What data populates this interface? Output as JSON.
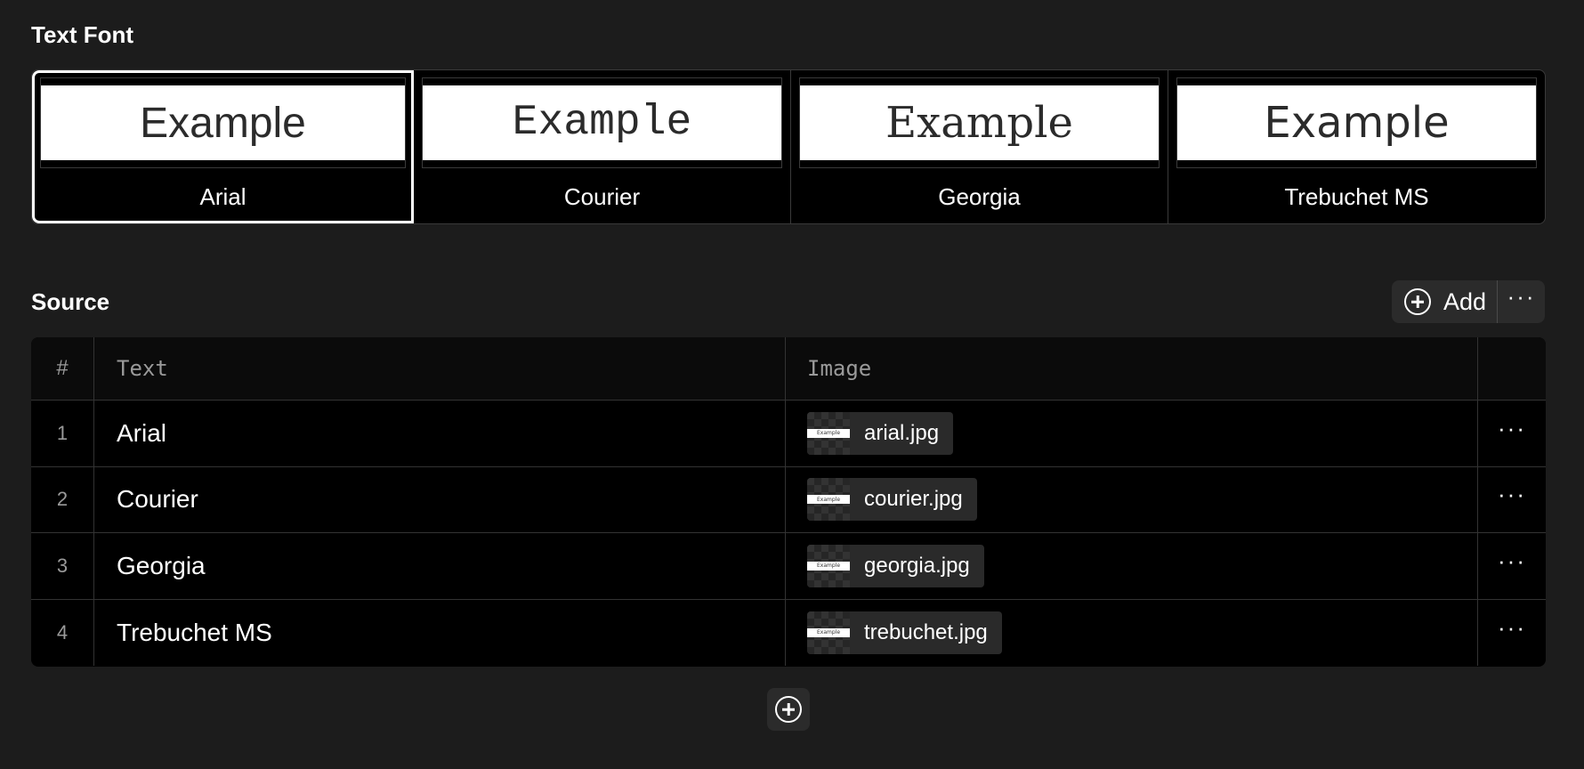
{
  "font_section": {
    "title": "Text Font",
    "preview_text": "Example",
    "options": [
      {
        "label": "Arial",
        "selected": true
      },
      {
        "label": "Courier",
        "selected": false
      },
      {
        "label": "Georgia",
        "selected": false
      },
      {
        "label": "Trebuchet MS",
        "selected": false
      }
    ]
  },
  "source_section": {
    "title": "Source",
    "add_label": "Add",
    "more_label": "···",
    "table": {
      "headers": {
        "num": "#",
        "text": "Text",
        "image": "Image"
      },
      "rows": [
        {
          "num": "1",
          "text": "Arial",
          "image": "arial.jpg",
          "thumb_text": "Example"
        },
        {
          "num": "2",
          "text": "Courier",
          "image": "courier.jpg",
          "thumb_text": "Example"
        },
        {
          "num": "3",
          "text": "Georgia",
          "image": "georgia.jpg",
          "thumb_text": "Example"
        },
        {
          "num": "4",
          "text": "Trebuchet MS",
          "image": "trebuchet.jpg",
          "thumb_text": "Example"
        }
      ],
      "row_menu_label": "···"
    }
  },
  "colors": {
    "background": "#1c1c1c",
    "panel": "#000000",
    "chip": "#2a2a2a",
    "text": "#ffffff",
    "muted": "#9a9a9a"
  }
}
